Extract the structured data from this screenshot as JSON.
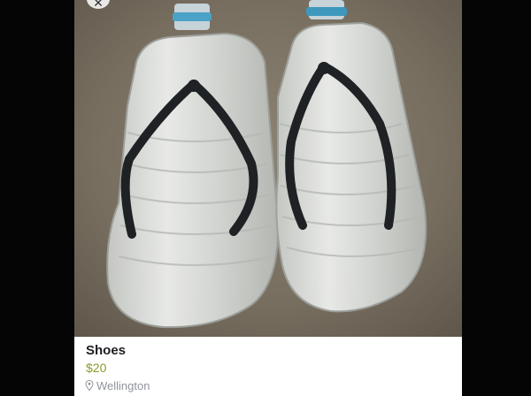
{
  "listing": {
    "title": "Shoes",
    "price": "$20",
    "location": "Wellington",
    "photo_alt": "Two sandals made from cut plastic water bottles with black straps"
  },
  "colors": {
    "price": "#8a9a2b",
    "title": "#1c1e21",
    "muted": "#90949c",
    "ground": "#7d7466"
  },
  "icons": [
    "close-icon",
    "location-pin-icon"
  ]
}
